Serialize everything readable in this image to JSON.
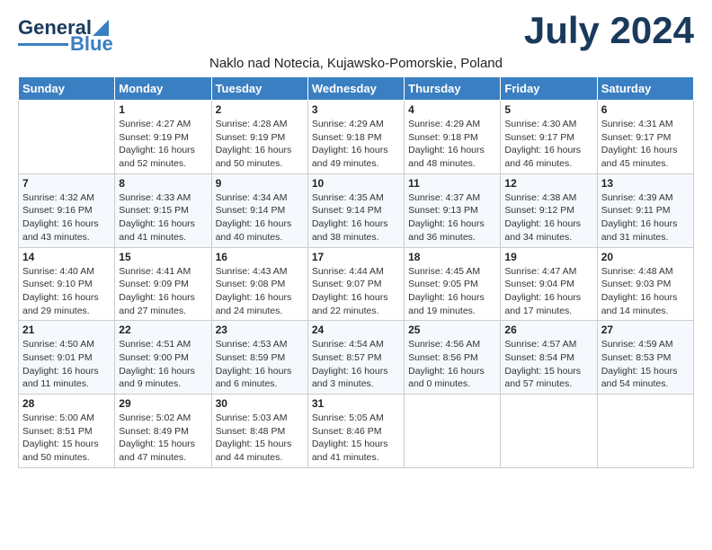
{
  "logo": {
    "text1": "General",
    "text2": "Blue"
  },
  "title": "July 2024",
  "subtitle": "Naklo nad Notecia, Kujawsko-Pomorskie, Poland",
  "headers": [
    "Sunday",
    "Monday",
    "Tuesday",
    "Wednesday",
    "Thursday",
    "Friday",
    "Saturday"
  ],
  "weeks": [
    [
      {
        "day": "",
        "info": ""
      },
      {
        "day": "1",
        "info": "Sunrise: 4:27 AM\nSunset: 9:19 PM\nDaylight: 16 hours\nand 52 minutes."
      },
      {
        "day": "2",
        "info": "Sunrise: 4:28 AM\nSunset: 9:19 PM\nDaylight: 16 hours\nand 50 minutes."
      },
      {
        "day": "3",
        "info": "Sunrise: 4:29 AM\nSunset: 9:18 PM\nDaylight: 16 hours\nand 49 minutes."
      },
      {
        "day": "4",
        "info": "Sunrise: 4:29 AM\nSunset: 9:18 PM\nDaylight: 16 hours\nand 48 minutes."
      },
      {
        "day": "5",
        "info": "Sunrise: 4:30 AM\nSunset: 9:17 PM\nDaylight: 16 hours\nand 46 minutes."
      },
      {
        "day": "6",
        "info": "Sunrise: 4:31 AM\nSunset: 9:17 PM\nDaylight: 16 hours\nand 45 minutes."
      }
    ],
    [
      {
        "day": "7",
        "info": "Sunrise: 4:32 AM\nSunset: 9:16 PM\nDaylight: 16 hours\nand 43 minutes."
      },
      {
        "day": "8",
        "info": "Sunrise: 4:33 AM\nSunset: 9:15 PM\nDaylight: 16 hours\nand 41 minutes."
      },
      {
        "day": "9",
        "info": "Sunrise: 4:34 AM\nSunset: 9:14 PM\nDaylight: 16 hours\nand 40 minutes."
      },
      {
        "day": "10",
        "info": "Sunrise: 4:35 AM\nSunset: 9:14 PM\nDaylight: 16 hours\nand 38 minutes."
      },
      {
        "day": "11",
        "info": "Sunrise: 4:37 AM\nSunset: 9:13 PM\nDaylight: 16 hours\nand 36 minutes."
      },
      {
        "day": "12",
        "info": "Sunrise: 4:38 AM\nSunset: 9:12 PM\nDaylight: 16 hours\nand 34 minutes."
      },
      {
        "day": "13",
        "info": "Sunrise: 4:39 AM\nSunset: 9:11 PM\nDaylight: 16 hours\nand 31 minutes."
      }
    ],
    [
      {
        "day": "14",
        "info": "Sunrise: 4:40 AM\nSunset: 9:10 PM\nDaylight: 16 hours\nand 29 minutes."
      },
      {
        "day": "15",
        "info": "Sunrise: 4:41 AM\nSunset: 9:09 PM\nDaylight: 16 hours\nand 27 minutes."
      },
      {
        "day": "16",
        "info": "Sunrise: 4:43 AM\nSunset: 9:08 PM\nDaylight: 16 hours\nand 24 minutes."
      },
      {
        "day": "17",
        "info": "Sunrise: 4:44 AM\nSunset: 9:07 PM\nDaylight: 16 hours\nand 22 minutes."
      },
      {
        "day": "18",
        "info": "Sunrise: 4:45 AM\nSunset: 9:05 PM\nDaylight: 16 hours\nand 19 minutes."
      },
      {
        "day": "19",
        "info": "Sunrise: 4:47 AM\nSunset: 9:04 PM\nDaylight: 16 hours\nand 17 minutes."
      },
      {
        "day": "20",
        "info": "Sunrise: 4:48 AM\nSunset: 9:03 PM\nDaylight: 16 hours\nand 14 minutes."
      }
    ],
    [
      {
        "day": "21",
        "info": "Sunrise: 4:50 AM\nSunset: 9:01 PM\nDaylight: 16 hours\nand 11 minutes."
      },
      {
        "day": "22",
        "info": "Sunrise: 4:51 AM\nSunset: 9:00 PM\nDaylight: 16 hours\nand 9 minutes."
      },
      {
        "day": "23",
        "info": "Sunrise: 4:53 AM\nSunset: 8:59 PM\nDaylight: 16 hours\nand 6 minutes."
      },
      {
        "day": "24",
        "info": "Sunrise: 4:54 AM\nSunset: 8:57 PM\nDaylight: 16 hours\nand 3 minutes."
      },
      {
        "day": "25",
        "info": "Sunrise: 4:56 AM\nSunset: 8:56 PM\nDaylight: 16 hours\nand 0 minutes."
      },
      {
        "day": "26",
        "info": "Sunrise: 4:57 AM\nSunset: 8:54 PM\nDaylight: 15 hours\nand 57 minutes."
      },
      {
        "day": "27",
        "info": "Sunrise: 4:59 AM\nSunset: 8:53 PM\nDaylight: 15 hours\nand 54 minutes."
      }
    ],
    [
      {
        "day": "28",
        "info": "Sunrise: 5:00 AM\nSunset: 8:51 PM\nDaylight: 15 hours\nand 50 minutes."
      },
      {
        "day": "29",
        "info": "Sunrise: 5:02 AM\nSunset: 8:49 PM\nDaylight: 15 hours\nand 47 minutes."
      },
      {
        "day": "30",
        "info": "Sunrise: 5:03 AM\nSunset: 8:48 PM\nDaylight: 15 hours\nand 44 minutes."
      },
      {
        "day": "31",
        "info": "Sunrise: 5:05 AM\nSunset: 8:46 PM\nDaylight: 15 hours\nand 41 minutes."
      },
      {
        "day": "",
        "info": ""
      },
      {
        "day": "",
        "info": ""
      },
      {
        "day": "",
        "info": ""
      }
    ]
  ]
}
